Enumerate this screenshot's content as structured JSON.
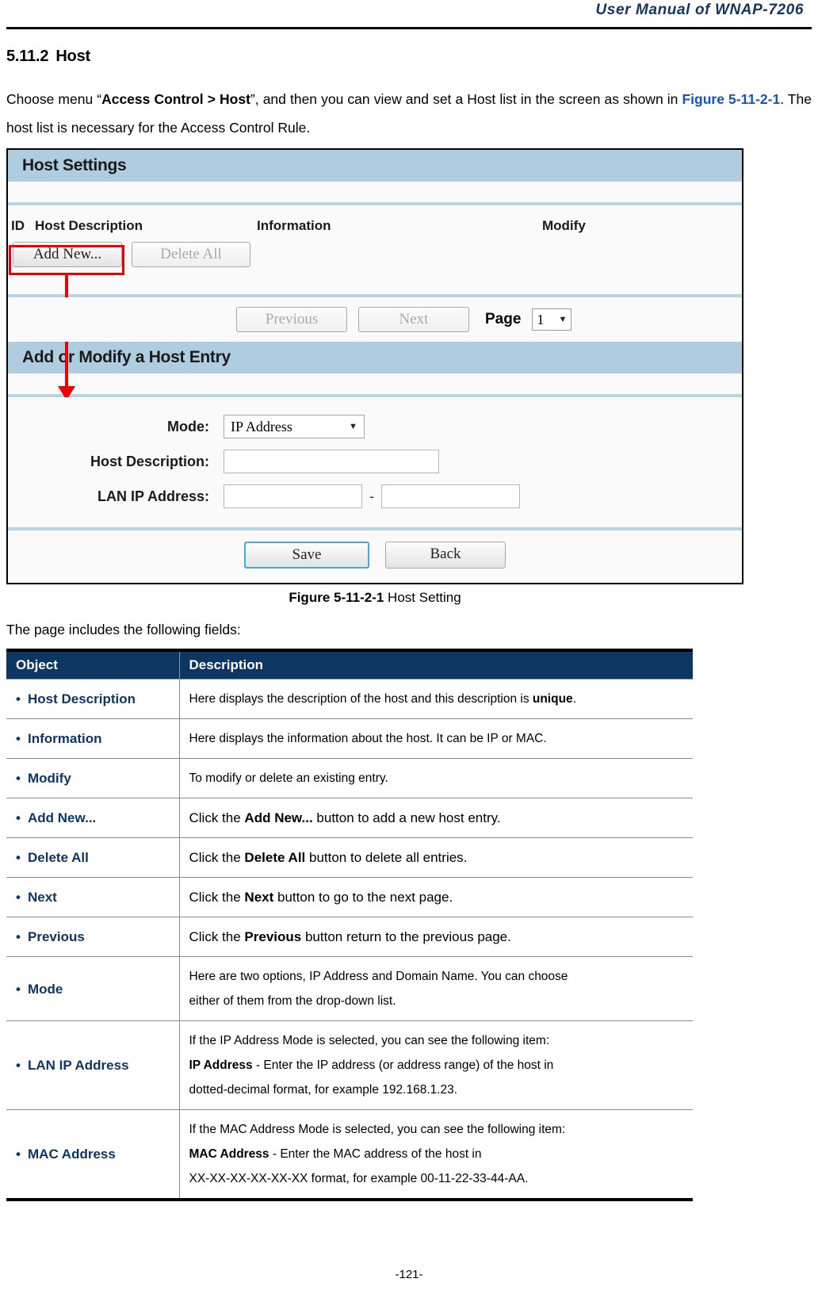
{
  "header": {
    "manual_title": "User Manual of WNAP-7206"
  },
  "section": {
    "number": "5.11.2",
    "title": "Host",
    "intro_1": "Choose menu “",
    "intro_menu_path": "Access Control > Host",
    "intro_2": "”, and then you can view and set a Host list in the screen as shown in ",
    "figure_ref": "Figure 5-11-2-1",
    "intro_3": ". The host list is necessary for the Access Control Rule."
  },
  "figure": {
    "caption_bold": "Figure 5-11-2-1",
    "caption_rest": " Host Setting",
    "ui": {
      "panel_title": "Host Settings",
      "list_headers": {
        "id": "ID",
        "host_description": "Host Description",
        "information": "Information",
        "modify": "Modify"
      },
      "add_new_button": "Add New...",
      "delete_all_button": "Delete All",
      "previous_button": "Previous",
      "next_button": "Next",
      "page_label": "Page",
      "page_value": "1",
      "entry_panel_title": "Add or Modify a Host Entry",
      "form": {
        "mode_label": "Mode:",
        "mode_value": "IP Address",
        "host_description_label": "Host Description:",
        "host_description_value": "",
        "lan_ip_label": "LAN IP Address:",
        "lan_ip_start_value": "",
        "lan_ip_end_value": "",
        "range_separator": "-"
      },
      "save_button": "Save",
      "back_button": "Back",
      "accent_highlight_color": "#ee0000",
      "panel_bar_color": "#aecde0"
    }
  },
  "fields_intro": "The page includes the following fields:",
  "fields_table": {
    "headers": {
      "object": "Object",
      "description": "Description"
    },
    "rows": [
      {
        "object": "Host Description",
        "desc_lines": [
          "Here displays the description of the host and this description is unique."
        ]
      },
      {
        "object": "Information",
        "desc_lines": [
          "Here displays the information about the host. It can be IP or MAC."
        ]
      },
      {
        "object": "Modify",
        "desc_lines": [
          "To modify or delete an existing entry."
        ]
      },
      {
        "object": "Add New...",
        "desc_lines": [
          "Click the Add New... button to add a new host entry."
        ]
      },
      {
        "object": "Delete All",
        "desc_lines": [
          "Click the Delete All button to delete all entries."
        ]
      },
      {
        "object": "Next",
        "desc_lines": [
          "Click the Next button to go to the next page."
        ]
      },
      {
        "object": "Previous",
        "desc_lines": [
          "Click the Previous button return to the previous page."
        ]
      },
      {
        "object": "Mode",
        "desc_lines": [
          "Here are two options, IP Address and Domain Name. You can choose",
          "either of them from the drop-down list."
        ]
      },
      {
        "object": "LAN IP Address",
        "desc_lines": [
          "If the IP Address Mode is selected, you can see the following item:",
          "IP Address - Enter the IP address (or address range) of the host in",
          "dotted-decimal format, for example 192.168.1.23."
        ]
      },
      {
        "object": "MAC Address",
        "desc_lines": [
          "If the MAC Address Mode is selected, you can see the following item:",
          "MAC Address - Enter the MAC address of the host in",
          "XX-XX-XX-XX-XX-XX format, for example 00-11-22-33-44-AA."
        ]
      }
    ]
  },
  "footer": {
    "page_number": "-121-"
  }
}
